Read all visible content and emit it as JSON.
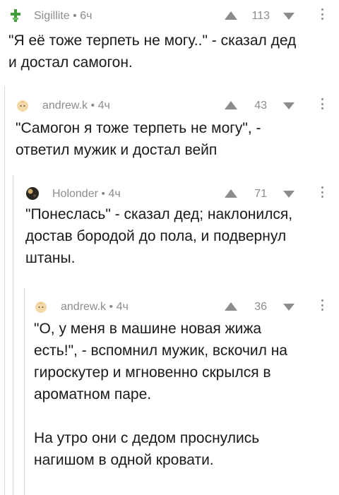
{
  "comments": [
    {
      "author": "Sigillite",
      "time": "6ч",
      "score": "113",
      "avatar_icon": "green-cross-icon",
      "text": [
        "\"Я её тоже терпеть не могу..\" - сказал дед",
        "и достал самогон."
      ]
    },
    {
      "author": "andrew.k",
      "time": "4ч",
      "score": "43",
      "avatar_icon": "face-avatar-icon",
      "text": [
        "\"Самогон я тоже терпеть не могу\", -",
        "ответил мужик и достал вейп"
      ]
    },
    {
      "author": "Holonder",
      "time": "4ч",
      "score": "71",
      "avatar_icon": "dark-planet-avatar-icon",
      "text": [
        "\"Понеслась\" - сказал дед; наклонился,",
        "достав бородой до пола, и подвернул",
        "штаны."
      ]
    },
    {
      "author": "andrew.k",
      "time": "4ч",
      "score": "36",
      "avatar_icon": "face-avatar-icon",
      "text": [
        "\"О, у меня в машине новая жижа",
        "есть!\", - вспомнил мужик, вскочил на",
        "гироскутер и мгновенно скрылся в",
        "ароматном паре."
      ],
      "text2": [
        "На утро они с дедом проснулись",
        "нагишом в одной кровати."
      ]
    }
  ],
  "separator": "•",
  "colors": {
    "meta": "#8c8c8c",
    "thread_line": "#d8d8d8",
    "text": "#1a1a1a"
  }
}
